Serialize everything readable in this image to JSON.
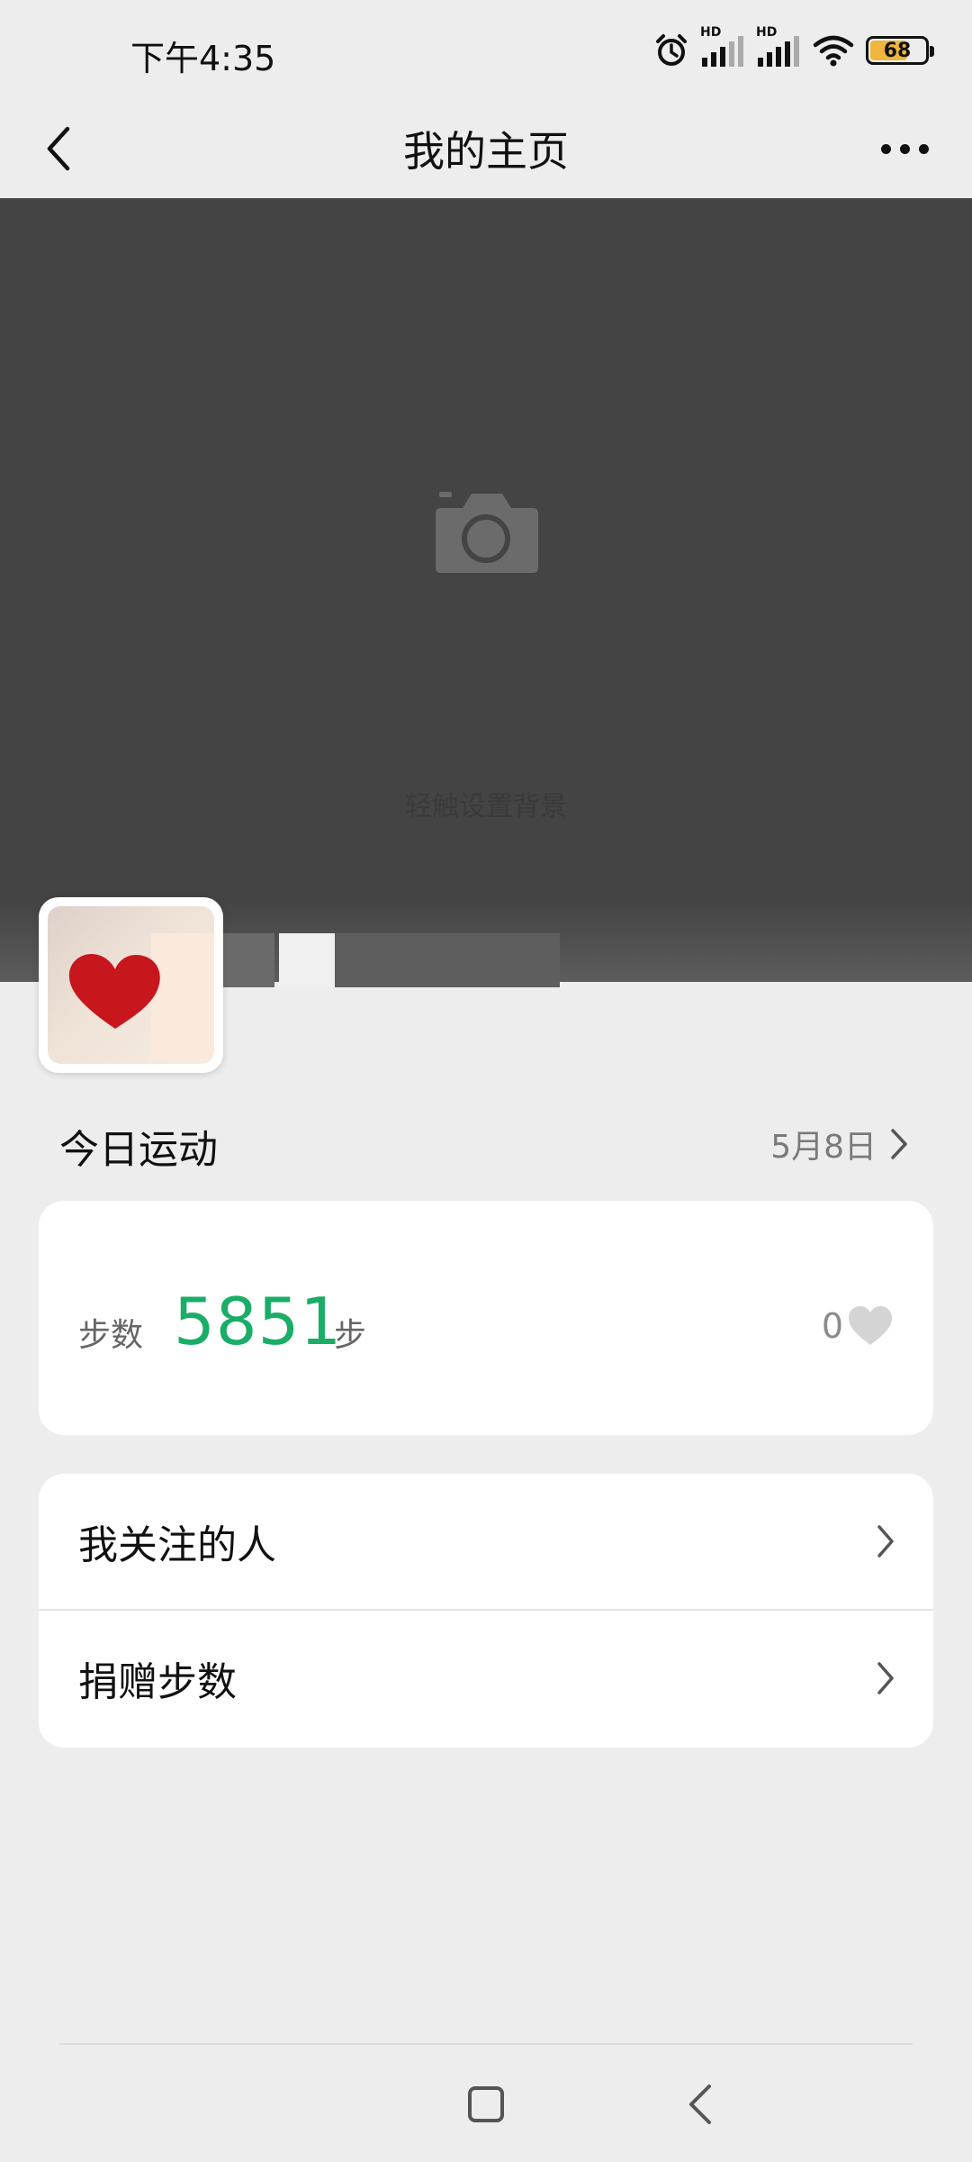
{
  "status_bar": {
    "time": "下午4:35",
    "hd1": "HD",
    "hd2": "HD",
    "battery": "68",
    "icons": [
      "alarm-icon",
      "signal-icon",
      "signal-icon",
      "wifi-icon",
      "battery-icon"
    ]
  },
  "header": {
    "title": "我的主页",
    "back_icon": "chevron-left-icon",
    "more_icon": "more-dots-icon"
  },
  "cover": {
    "hint": "轻触设置背景",
    "icon": "camera-icon"
  },
  "today": {
    "title": "今日运动",
    "date": "5月8日"
  },
  "steps": {
    "label": "步数",
    "value": "5851",
    "unit": "步",
    "likes": "0"
  },
  "menu": [
    {
      "label": "我关注的人"
    },
    {
      "label": "捐赠步数"
    }
  ],
  "colors": {
    "accent_green": "#1aad67",
    "background": "#ededed",
    "cover": "#444444"
  }
}
